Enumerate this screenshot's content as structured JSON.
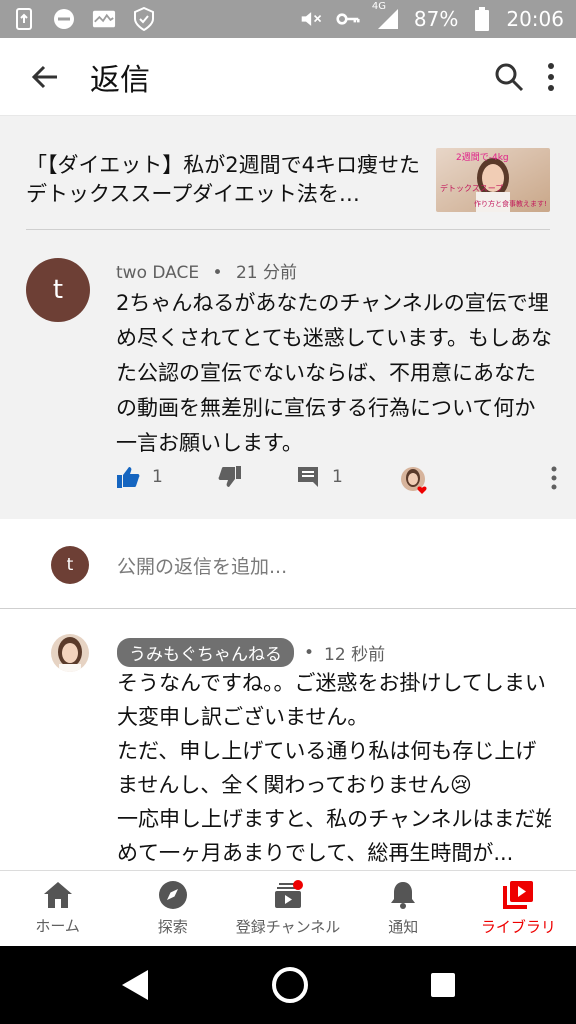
{
  "status_bar": {
    "network": "4G",
    "battery": "87%",
    "time": "20:06",
    "left_icons": [
      "screenshot-icon",
      "dnd-icon",
      "activity-icon",
      "shield-icon"
    ]
  },
  "app_bar": {
    "title": "返信",
    "back_icon": "arrow-back-icon",
    "search_icon": "search-icon",
    "more_icon": "more-vert-icon"
  },
  "video": {
    "title": "「【ダイエット】私が2週間で4キロ痩せたデトックススープダイエット法を…",
    "thumb_text_1": "2週間で-4kg",
    "thumb_text_2": "デトックススープ",
    "thumb_text_3": "作り方と食事教えます!"
  },
  "comment": {
    "avatar_letter": "t",
    "author": "two DACE",
    "separator": "•",
    "time": "21 分前",
    "text": "2ちゃんねるがあなたのチャンネルの宣伝で埋め尽くされてとても迷惑しています。もしあなた公認の宣伝でないならば、不用意にあなたの動画を無差別に宣伝する行為について何か一言お願いします。",
    "like_count": "1",
    "reply_count": "1"
  },
  "reply_input": {
    "avatar_letter": "t",
    "placeholder": "公開の返信を追加..."
  },
  "reply": {
    "author": "うみもぐちゃんねる",
    "separator": "•",
    "time": "12 秒前",
    "text": "そうなんですね。。ご迷惑をお掛けしてしまい大変申し訳ございません。\nただ、申し上げている通り私は何も存じ上げませんし、全く関わっておりません😢\n一応申し上げますと、私のチャンネルはまだ始めて一ヶ月あまりでして、総再生時間が..."
  },
  "bottom_nav": {
    "tabs": [
      {
        "label": "ホーム",
        "icon": "home-icon"
      },
      {
        "label": "探索",
        "icon": "explore-icon"
      },
      {
        "label": "登録チャンネル",
        "icon": "subscriptions-icon"
      },
      {
        "label": "通知",
        "icon": "bell-icon"
      },
      {
        "label": "ライブラリ",
        "icon": "library-icon"
      }
    ],
    "active_color": "#e00000"
  },
  "colors": {
    "accent": "#e00000",
    "like_blue": "#1565c0",
    "avatar_brown": "#6d3f35"
  }
}
